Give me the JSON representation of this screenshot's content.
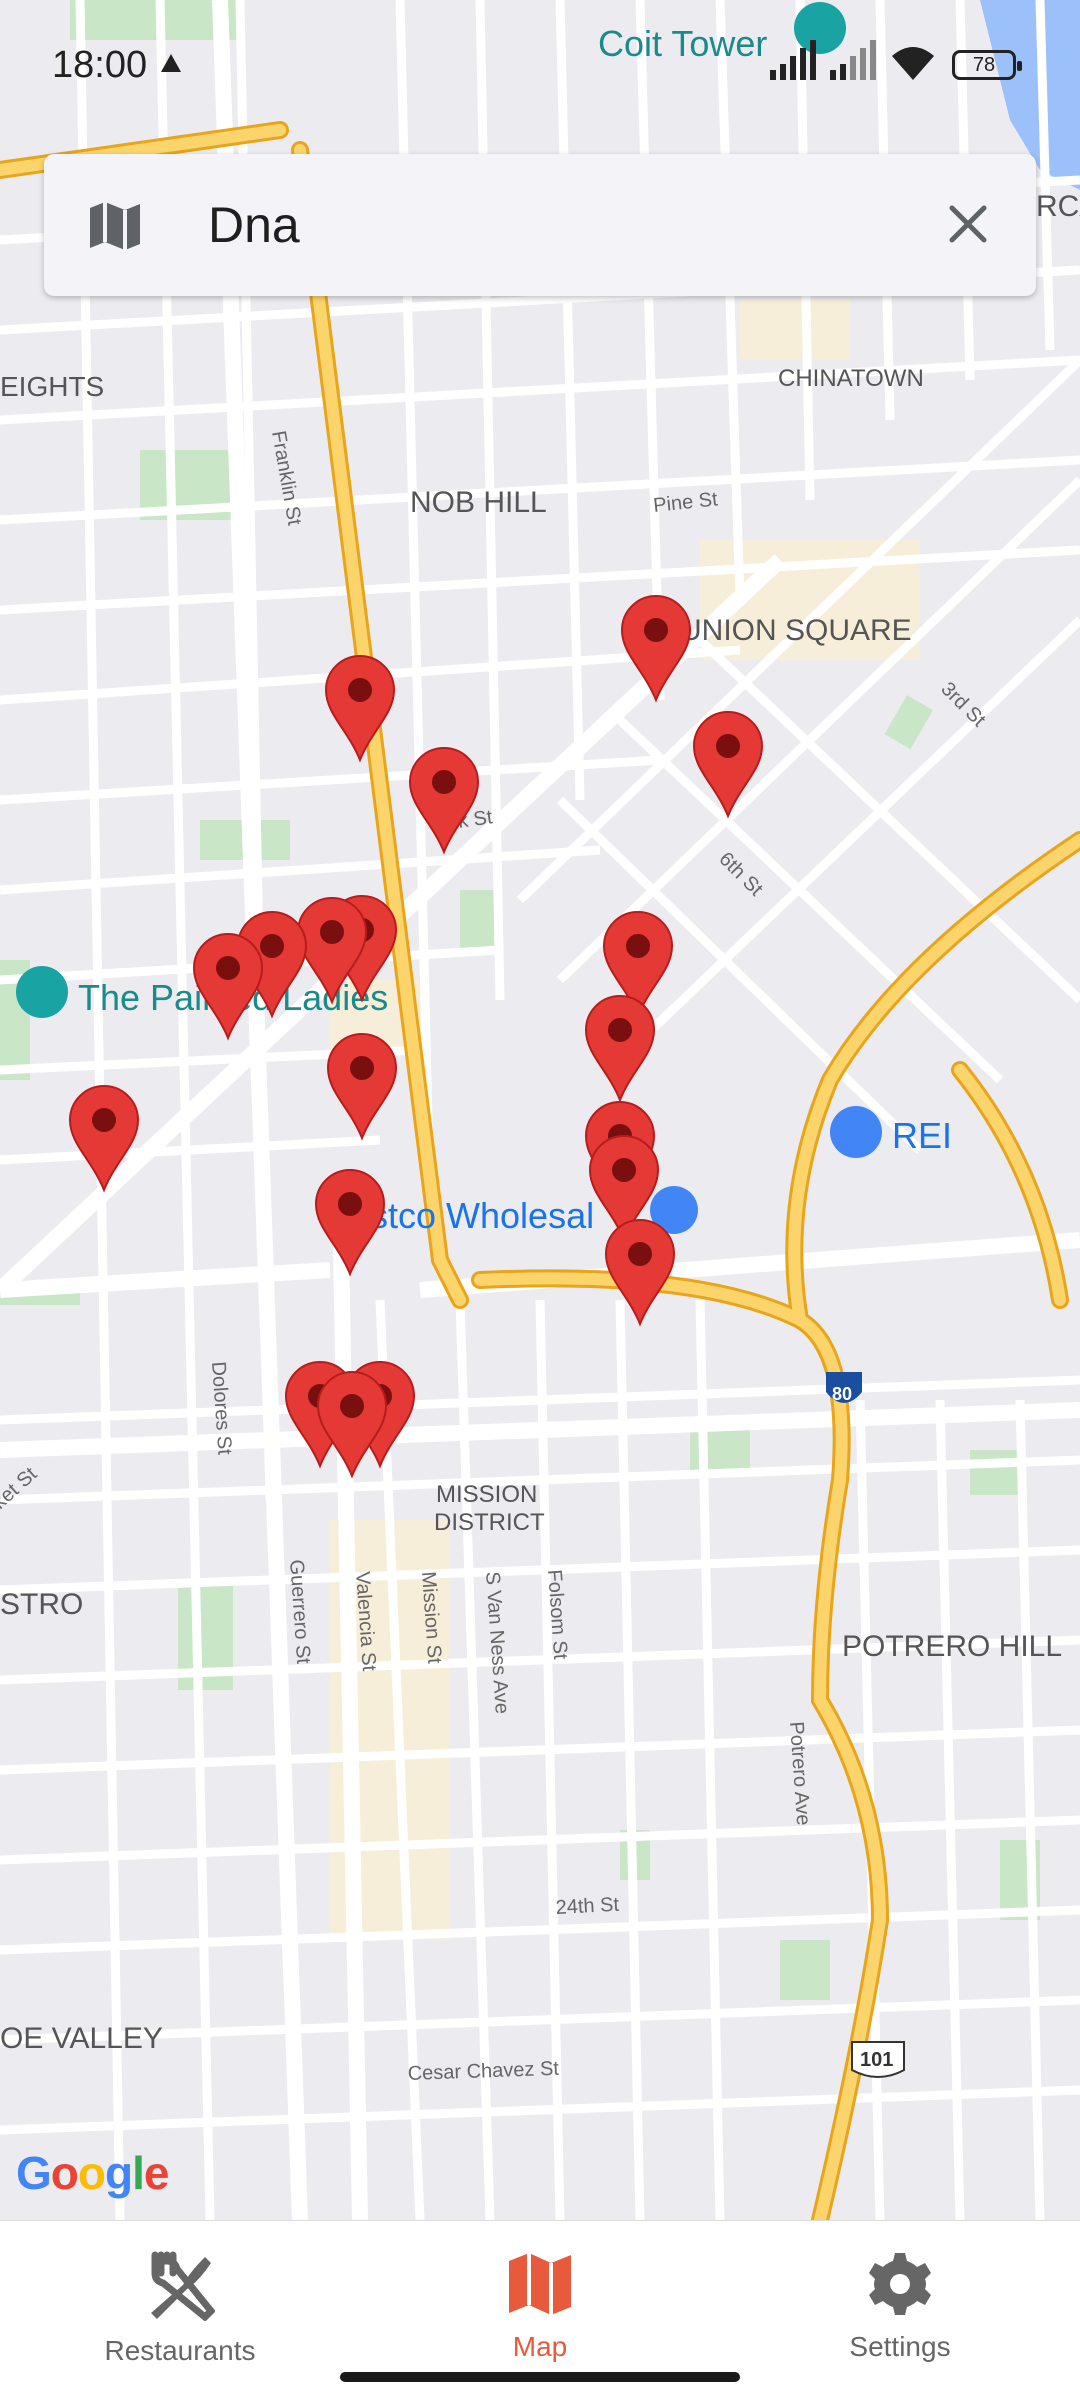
{
  "status_bar": {
    "time": "18:00",
    "battery": "78"
  },
  "search": {
    "query": "Dna"
  },
  "map": {
    "labels": {
      "coit_tower": "Coit Tower",
      "heights": "EIGHTS",
      "chinatown": "CHINATOWN",
      "nob_hill": "NOB HILL",
      "pine_st": "Pine St",
      "franklin_st": "Franklin St",
      "union_square": "UNION SQUARE",
      "third_st": "3rd St",
      "turk_st": "Turk St",
      "sixth_st": "6th St",
      "painted_ladies": "The Painted Ladies",
      "rei": "REI",
      "costco": "stco Wholesal",
      "dolores_st": "Dolores St",
      "mission_district_1": "MISSION",
      "mission_district_2": "DISTRICT",
      "guerrero_st": "Guerrero St",
      "valencia_st": "Valencia St",
      "mission_st": "Mission St",
      "s_van_ness_ave": "S Van Ness Ave",
      "folsom_st": "Folsom St",
      "castro": "STRO",
      "potrero_hill": "POTRERO HILL",
      "potrero_ave": "Potrero Ave",
      "twentyfourth_st": "24th St",
      "noe_valley": "OE VALLEY",
      "cesar_chavez": "Cesar Chavez St",
      "market_st": "ket St",
      "rca": "RCA",
      "i80": "80",
      "us101": "101"
    },
    "attribution": "Google"
  },
  "nav": {
    "restaurants": "Restaurants",
    "map": "Map",
    "settings": "Settings"
  },
  "colors": {
    "accent": "#e85a3c",
    "pin": "#e53935",
    "road": "#f8c64a"
  }
}
